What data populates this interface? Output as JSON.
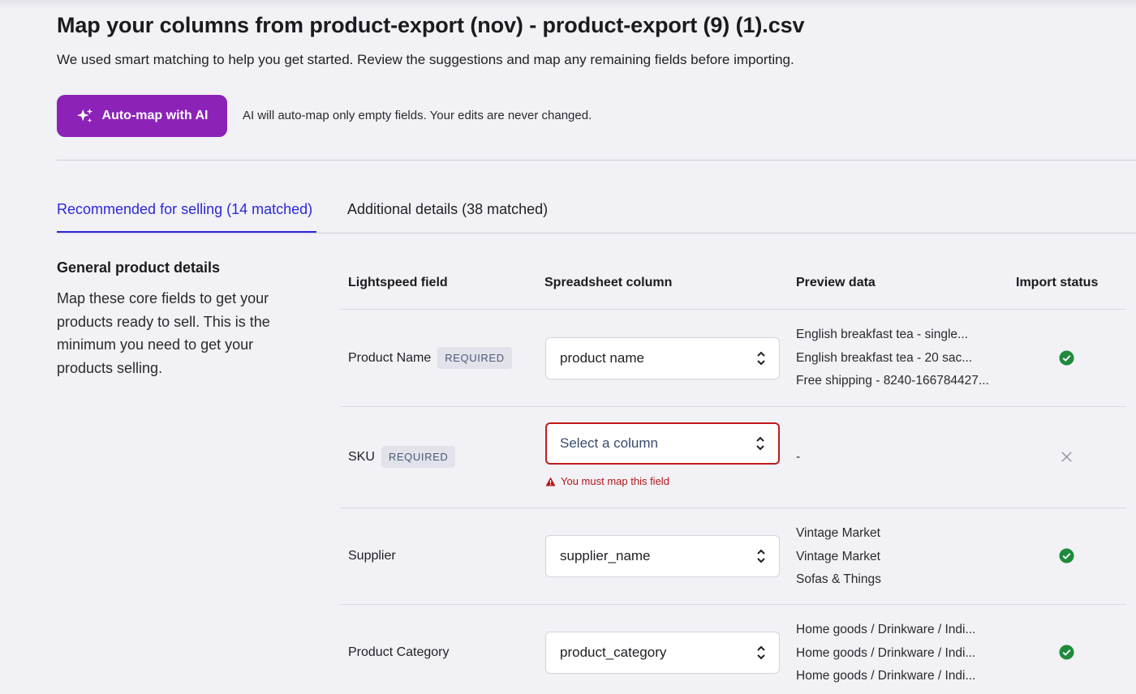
{
  "header": {
    "title": "Map your columns from product-export (nov) - product-export (9) (1).csv",
    "subtitle": "We used smart matching to help you get started. Review the suggestions and map any remaining fields before importing."
  },
  "automap": {
    "button_label": "Auto-map with AI",
    "note": "AI will auto-map only empty fields. Your edits are never changed.",
    "icon": "sparkle-icon"
  },
  "tabs": [
    {
      "label": "Recommended for selling (14 matched)",
      "active": true
    },
    {
      "label": "Additional details (38 matched)",
      "active": false
    }
  ],
  "section": {
    "heading": "General product details",
    "description": "Map these core fields to get your products ready to sell. This is the minimum you need to get your products selling."
  },
  "table": {
    "headers": [
      "Lightspeed field",
      "Spreadsheet column",
      "Preview data",
      "Import status"
    ],
    "rows": [
      {
        "field": "Product Name",
        "badge": "REQUIRED",
        "column": "product name",
        "preview": [
          "English breakfast tea - single...",
          "English breakfast tea - 20 sac...",
          "Free shipping - 8240-166784427..."
        ],
        "status": "matched"
      },
      {
        "field": "SKU",
        "badge": "REQUIRED",
        "column": "Select a column",
        "error": "You must map this field",
        "preview": [
          "-"
        ],
        "status": "unmapped"
      },
      {
        "field": "Supplier",
        "column": "supplier_name",
        "preview": [
          "Vintage Market",
          "Vintage Market",
          "Sofas & Things"
        ],
        "status": "matched"
      },
      {
        "field": "Product Category",
        "column": "product_category",
        "preview": [
          "Home goods / Drinkware / Indi...",
          "Home goods / Drinkware / Indi...",
          "Home goods / Drinkware / Indi..."
        ],
        "status": "matched"
      }
    ]
  },
  "colors": {
    "accent": "#2d28d6",
    "ai_button": "#8c22b8",
    "error": "#c11a1a",
    "success": "#1f8a3b"
  }
}
